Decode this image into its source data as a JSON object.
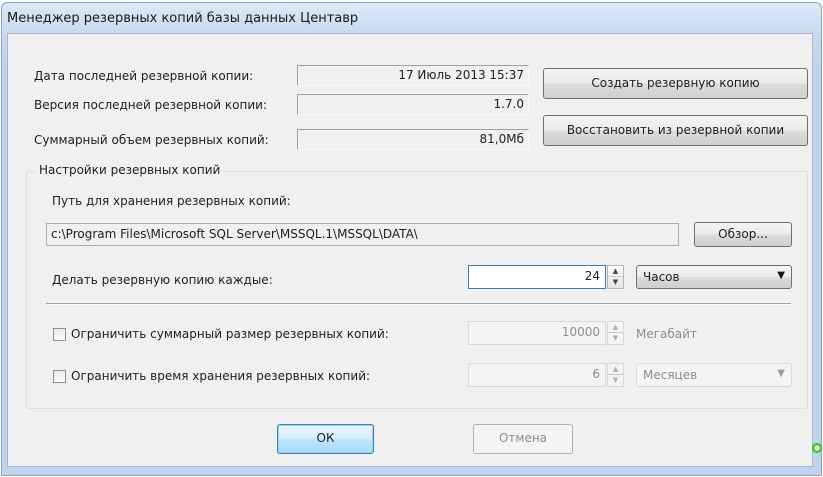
{
  "window": {
    "title": "Менеджер резервных копий базы данных Центавр"
  },
  "info": {
    "last_backup_date_label": "Дата последней резервной копии:",
    "last_backup_date_value": "17 Июль 2013 15:37",
    "last_backup_version_label": "Версия последней резервной копии:",
    "last_backup_version_value": "1.7.0",
    "total_size_label": "Суммарный объем резервных копий:",
    "total_size_value": "81,0Мб"
  },
  "actions": {
    "create_backup": "Создать резервную копию",
    "restore_backup": "Восстановить из резервной копии"
  },
  "settings": {
    "group_title": "Настройки резервных копий",
    "path_label": "Путь для хранения резервных копий:",
    "path_value": "c:\\Program Files\\Microsoft SQL Server\\MSSQL.1\\MSSQL\\DATA\\",
    "browse_button": "Обзор...",
    "interval_label": "Делать резервную копию каждые:",
    "interval_value": "24",
    "interval_unit": "Часов",
    "limit_size_label": "Ограничить суммарный размер резервных копий:",
    "limit_size_checked": false,
    "limit_size_value": "10000",
    "limit_size_unit": "Мегабайт",
    "limit_time_label": "Ограничить время хранения резервных копий:",
    "limit_time_checked": false,
    "limit_time_value": "6",
    "limit_time_unit": "Месяцев"
  },
  "footer": {
    "ok": "ОК",
    "cancel": "Отмена",
    "status_color": "#2fbf2f"
  },
  "icons": {
    "spin_up": "▲",
    "spin_down": "▼",
    "dropdown": "▼"
  }
}
